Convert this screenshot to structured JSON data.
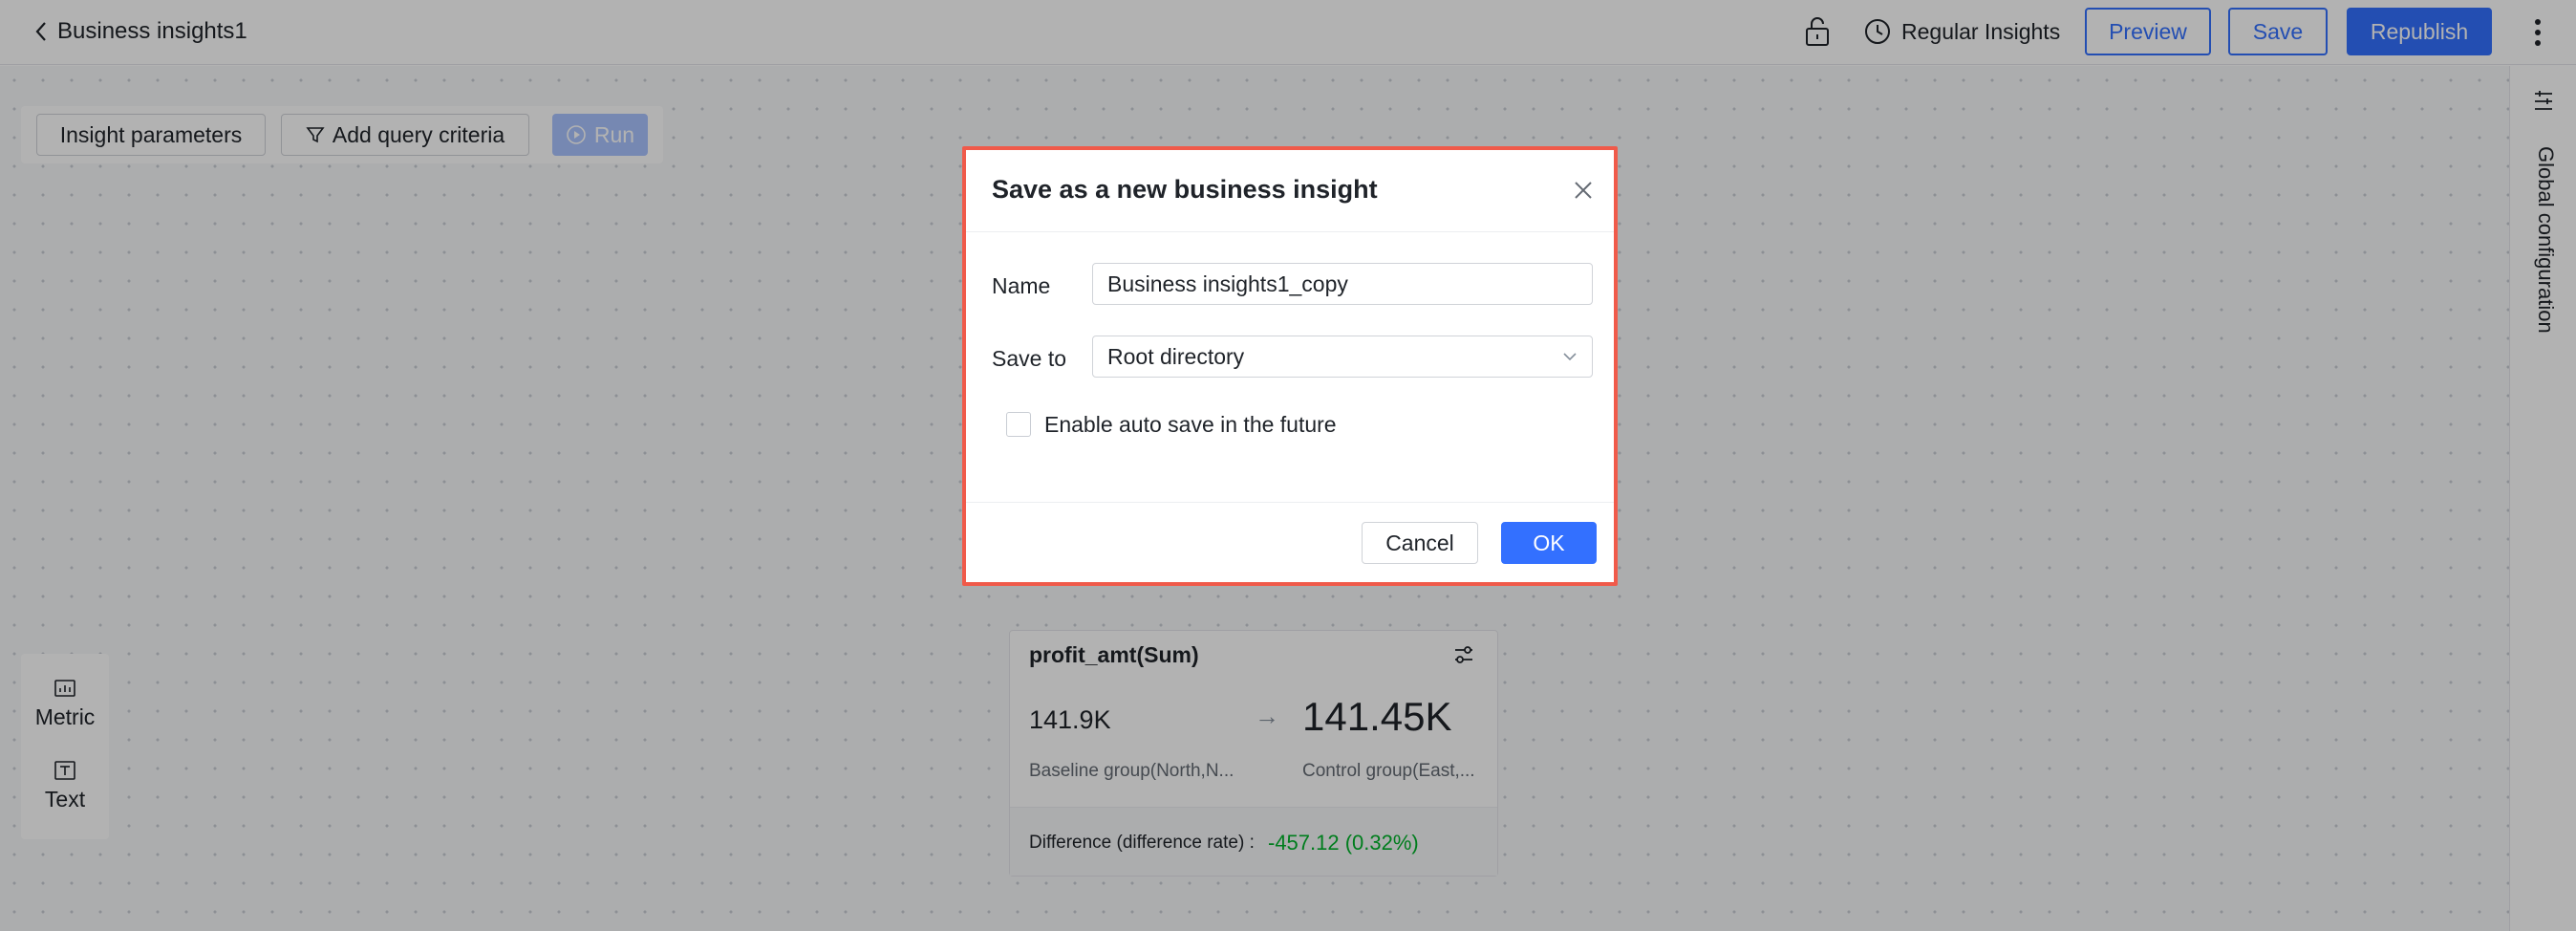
{
  "header": {
    "title": "Business insights1",
    "regular_insights": "Regular Insights",
    "preview_label": "Preview",
    "save_label": "Save",
    "republish_label": "Republish"
  },
  "toolbar": {
    "insight_parameters": "Insight parameters",
    "add_query_criteria": "Add query criteria",
    "run": "Run"
  },
  "left_panel": {
    "items": [
      {
        "label": "Metric",
        "icon": "metric-icon"
      },
      {
        "label": "Text",
        "icon": "text-icon"
      }
    ]
  },
  "metric_card": {
    "title": "profit_amt(Sum)",
    "baseline_value": "141.9K",
    "control_value": "141.45K",
    "baseline_label": "Baseline group(North,N...",
    "control_label": "Control group(East,...",
    "difference_label": "Difference (difference rate) :",
    "difference_value": "-457.12 (0.32%)",
    "difference_color": "#00b42a"
  },
  "right_sidebar": {
    "label": "Global configuration"
  },
  "dialog": {
    "title": "Save as a new business insight",
    "name_label": "Name",
    "name_value": "Business insights1_copy",
    "save_to_label": "Save to",
    "save_to_value": "Root directory",
    "auto_save_label": "Enable auto save in the future",
    "auto_save_checked": false,
    "cancel_label": "Cancel",
    "ok_label": "OK"
  },
  "colors": {
    "primary": "#3370ff",
    "dialog_highlight": "#f05a4a",
    "success": "#00b42a"
  }
}
